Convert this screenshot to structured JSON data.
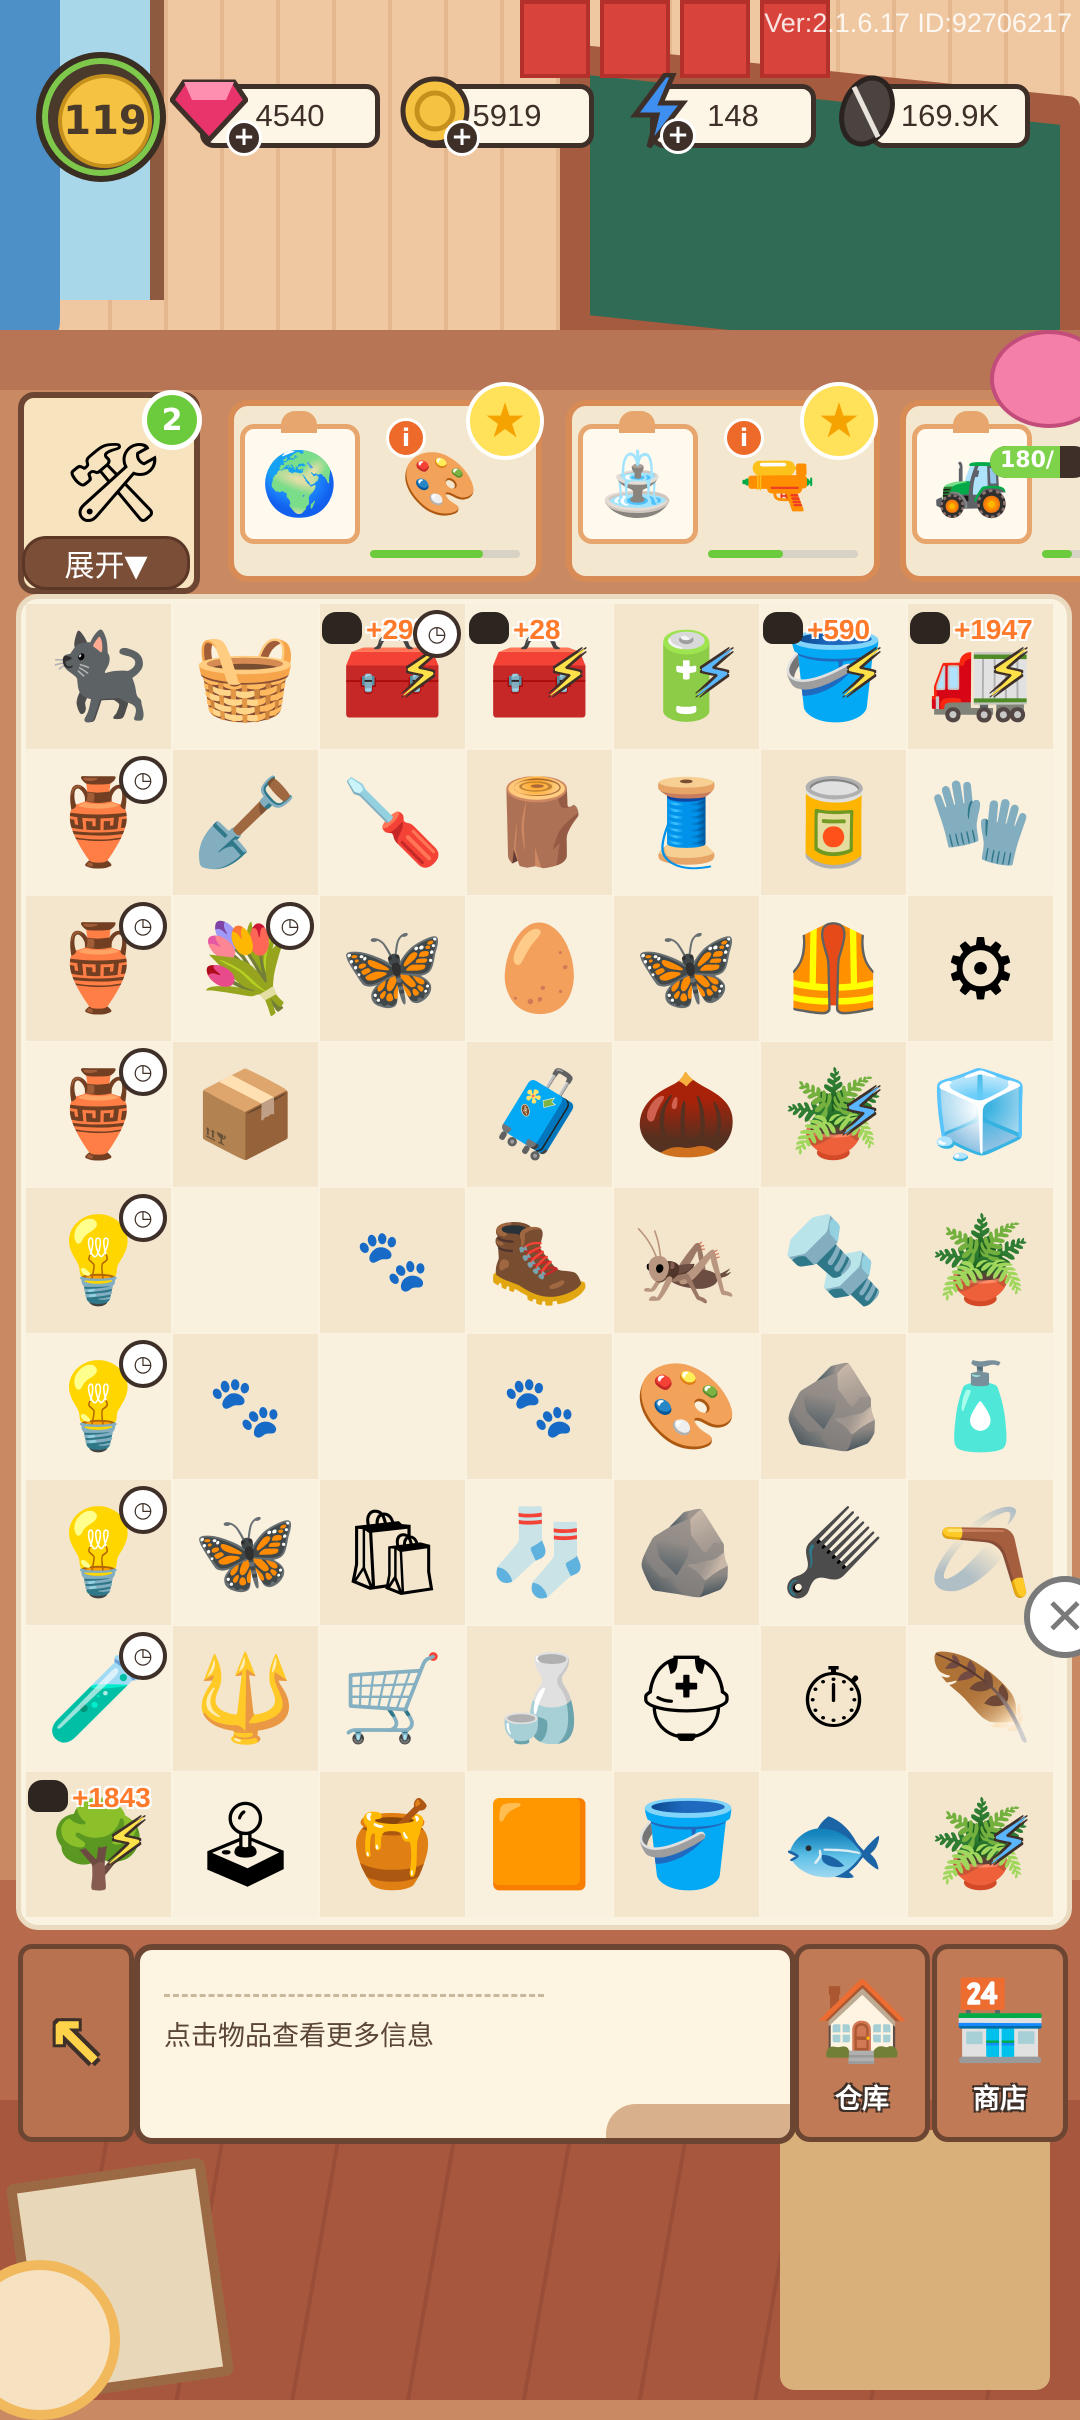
{
  "version": "Ver:2.1.6.17 ID:92706217",
  "hud": {
    "level": "119",
    "gems": "4540",
    "coins": "5919",
    "energy": "148",
    "seeds": "169.9K",
    "gem_color": "#e8336b",
    "coin_color": "#f5c242",
    "energy_color": "#3f8ff0"
  },
  "orders": {
    "expand_label": "展开▼",
    "expand_count": "2",
    "cards": [
      {
        "items": [
          "🌍",
          "🎨"
        ],
        "progress": 0.75
      },
      {
        "items": [
          "⛲",
          "🔫"
        ],
        "progress": 0.5
      },
      {
        "items": [
          "🚜"
        ],
        "progress": 0.5
      }
    ],
    "piggy_progress": "180/"
  },
  "board": {
    "rows": [
      [
        {
          "icon": "🐈‍⬛"
        },
        {
          "icon": "🧺"
        },
        {
          "icon": "🧰",
          "bonus": "+293",
          "clock": true,
          "bolt": "yellow"
        },
        {
          "icon": "🧰",
          "bonus": "+28",
          "bolt": "yellow"
        },
        {
          "icon": "🔋",
          "bolt": "blue"
        },
        {
          "icon": "🪣",
          "bonus": "+590",
          "bolt": "yellow"
        },
        {
          "icon": "🚛",
          "bonus": "+1947",
          "bolt": "yellow"
        }
      ],
      [
        {
          "icon": "🏺",
          "clock": true
        },
        {
          "icon": "🪏"
        },
        {
          "icon": "🪛"
        },
        {
          "icon": "🪵"
        },
        {
          "icon": "🧵"
        },
        {
          "icon": "🥫"
        },
        {
          "icon": "🧤"
        }
      ],
      [
        {
          "icon": "🏺",
          "clock": true
        },
        {
          "icon": "💐",
          "clock": true
        },
        {
          "icon": "🦋"
        },
        {
          "icon": "🥚"
        },
        {
          "icon": "🦋"
        },
        {
          "icon": "🦺"
        },
        {
          "icon": "⚙"
        }
      ],
      [
        {
          "icon": "🏺",
          "clock": true
        },
        {
          "icon": "📦"
        },
        {
          "icon": ""
        },
        {
          "icon": "🧳"
        },
        {
          "icon": "🌰"
        },
        {
          "icon": "🪴",
          "bolt": "blue"
        },
        {
          "icon": "🧊"
        }
      ],
      [
        {
          "icon": "💡",
          "clock": true
        },
        {
          "icon": ""
        },
        {
          "icon": "",
          "paw": true
        },
        {
          "icon": "🥾"
        },
        {
          "icon": "🦗"
        },
        {
          "icon": "🔩"
        },
        {
          "icon": "🪴"
        }
      ],
      [
        {
          "icon": "💡",
          "clock": true
        },
        {
          "icon": "",
          "paw": true
        },
        {
          "icon": ""
        },
        {
          "icon": "",
          "paw": true
        },
        {
          "icon": "🎨"
        },
        {
          "icon": "🪨"
        },
        {
          "icon": "🧴"
        }
      ],
      [
        {
          "icon": "💡",
          "clock": true
        },
        {
          "icon": "🦋"
        },
        {
          "icon": "🛍"
        },
        {
          "icon": "🧦"
        },
        {
          "icon": "🪨"
        },
        {
          "icon": "🪮"
        },
        {
          "icon": "🪃"
        }
      ],
      [
        {
          "icon": "🧪",
          "clock": true
        },
        {
          "icon": "🔱"
        },
        {
          "icon": "🛒"
        },
        {
          "icon": "🍶"
        },
        {
          "icon": "⛑"
        },
        {
          "icon": "⏱"
        },
        {
          "icon": "🪶"
        }
      ],
      [
        {
          "icon": "🌳",
          "bonus": "+1843",
          "bolt": "yellow"
        },
        {
          "icon": "🕹"
        },
        {
          "icon": "🍯"
        },
        {
          "icon": "🟧"
        },
        {
          "icon": "🪣"
        },
        {
          "icon": "🐟"
        },
        {
          "icon": "🪴",
          "bolt": "blue"
        }
      ]
    ]
  },
  "bottom": {
    "info_text": "点击物品查看更多信息",
    "warehouse_label": "仓库",
    "shop_label": "商店"
  }
}
